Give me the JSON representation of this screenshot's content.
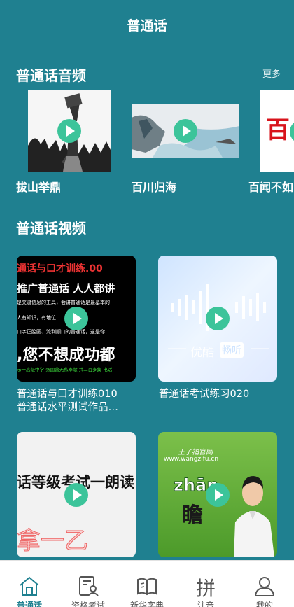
{
  "header": {
    "title": "普通话"
  },
  "audio_section": {
    "title": "普通话音频",
    "more_label": "更多",
    "items": [
      {
        "label": "拔山举鼎",
        "thumb": "statue photo"
      },
      {
        "label": "百川归海",
        "thumb": "sea painting"
      },
      {
        "label": "百闻不如",
        "thumb_text": "百"
      }
    ]
  },
  "video_section": {
    "title": "普通话视频",
    "items": [
      {
        "title_line1": "普通话与口才训练010",
        "title_line2": "普通话水平测试作品…",
        "thumb_lines": [
          "通话与口才训练.00",
          "推广普通话 人人都讲",
          "是交流信息的工具，会讲普通话是最基本的",
          "人有知识，有地位",
          "口字正腔圆、流利顺口的普通话，这是你",
          ",您不想成功都",
          "示一高级中学  张国营无私奉献 共二百多集 电话"
        ]
      },
      {
        "title_line1": "普通话考试练习020",
        "thumb_brand": "优酷",
        "thumb_brand_tag": "畅听"
      },
      {
        "thumb_line": "话等级考试一朗读",
        "thumb_red": "拿一乙"
      },
      {
        "thumb_tag1": "王子福官网",
        "thumb_url": "www.wangzifu.cn",
        "thumb_pinyin": "zhān",
        "thumb_char": "瞻"
      }
    ]
  },
  "bottom_nav": {
    "tabs": [
      {
        "label": "普通话",
        "icon": "home-icon",
        "active": true
      },
      {
        "label": "资格考试",
        "icon": "exam-certificate-icon",
        "active": false
      },
      {
        "label": "新华字典",
        "icon": "book-icon",
        "active": false
      },
      {
        "label": "注音",
        "icon_text": "拼",
        "active": false
      },
      {
        "label": "我的",
        "icon": "user-icon",
        "active": false
      }
    ]
  },
  "colors": {
    "background": "#1f8090",
    "play_button": "#3cc49a",
    "active_tab": "#1f8090"
  }
}
